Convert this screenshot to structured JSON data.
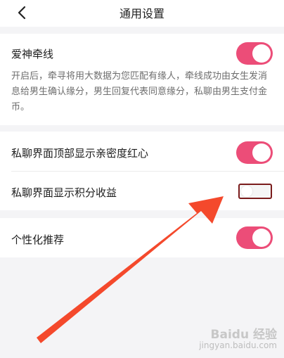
{
  "header": {
    "title": "通用设置"
  },
  "settings": {
    "cupid": {
      "label": "爱神牵线",
      "enabled": true,
      "description": "开启后，牵寻将用大数据为您匹配有缘人，牵线成功由女生发消息给男生确认缘分，男生回复代表同意缘分，私聊由男生支付金币。"
    },
    "intimacy_heart": {
      "label": "私聊界面顶部显示亲密度红心",
      "enabled": true
    },
    "points_income": {
      "label": "私聊界面显示积分收益",
      "enabled": false
    },
    "personalized": {
      "label": "个性化推荐",
      "enabled": true
    }
  },
  "colors": {
    "toggle_on": "#ec4d78",
    "annotation_arrow": "#f4492c",
    "highlight_box": "#7a1c1c"
  },
  "watermark": {
    "brand": "Baidu 经验",
    "url": "jingyan.baidu.com"
  }
}
